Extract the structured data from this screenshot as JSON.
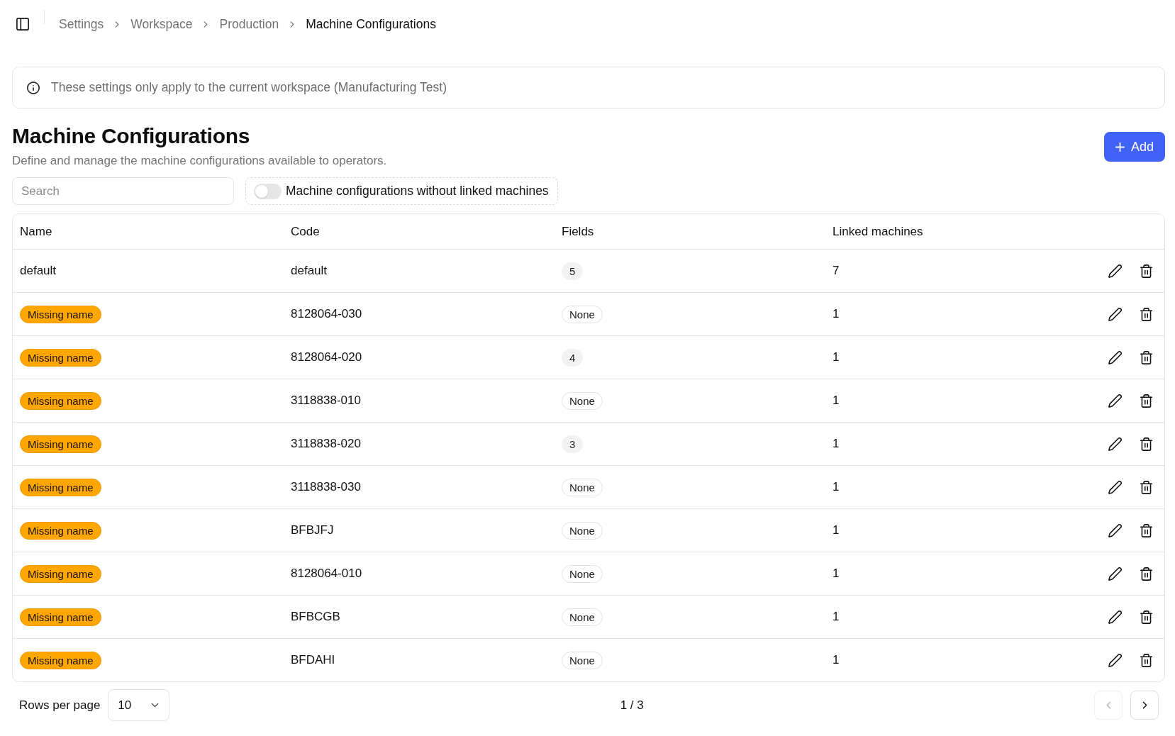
{
  "topbar": {
    "breadcrumb": [
      {
        "label": "Settings",
        "current": false
      },
      {
        "label": "Workspace",
        "current": false
      },
      {
        "label": "Production",
        "current": false
      },
      {
        "label": "Machine Configurations",
        "current": true
      }
    ]
  },
  "notice": {
    "text": "These settings only apply to the current workspace (Manufacturing Test)"
  },
  "header": {
    "title": "Machine Configurations",
    "subtitle": "Define and manage the machine configurations available to operators.",
    "add_button": "Add"
  },
  "filters": {
    "search": {
      "placeholder": "Search"
    },
    "toggle": {
      "label": "Machine configurations without linked machines",
      "on": false
    }
  },
  "table": {
    "columns": [
      "Name",
      "Code",
      "Fields",
      "Linked machines"
    ],
    "rows": [
      {
        "name": {
          "kind": "text",
          "text": "default"
        },
        "code": "default",
        "fields": {
          "kind": "count",
          "text": "5"
        },
        "linked_machines": "7"
      },
      {
        "name": {
          "kind": "warning",
          "text": "Missing name"
        },
        "code": "8128064-030",
        "fields": {
          "kind": "empty",
          "text": "None"
        },
        "linked_machines": "1"
      },
      {
        "name": {
          "kind": "warning",
          "text": "Missing name"
        },
        "code": "8128064-020",
        "fields": {
          "kind": "count",
          "text": "4"
        },
        "linked_machines": "1"
      },
      {
        "name": {
          "kind": "warning",
          "text": "Missing name"
        },
        "code": "3118838-010",
        "fields": {
          "kind": "empty",
          "text": "None"
        },
        "linked_machines": "1"
      },
      {
        "name": {
          "kind": "warning",
          "text": "Missing name"
        },
        "code": "3118838-020",
        "fields": {
          "kind": "count",
          "text": "3"
        },
        "linked_machines": "1"
      },
      {
        "name": {
          "kind": "warning",
          "text": "Missing name"
        },
        "code": "3118838-030",
        "fields": {
          "kind": "empty",
          "text": "None"
        },
        "linked_machines": "1"
      },
      {
        "name": {
          "kind": "warning",
          "text": "Missing name"
        },
        "code": "BFBJFJ",
        "fields": {
          "kind": "empty",
          "text": "None"
        },
        "linked_machines": "1"
      },
      {
        "name": {
          "kind": "warning",
          "text": "Missing name"
        },
        "code": "8128064-010",
        "fields": {
          "kind": "empty",
          "text": "None"
        },
        "linked_machines": "1"
      },
      {
        "name": {
          "kind": "warning",
          "text": "Missing name"
        },
        "code": "BFBCGB",
        "fields": {
          "kind": "empty",
          "text": "None"
        },
        "linked_machines": "1"
      },
      {
        "name": {
          "kind": "warning",
          "text": "Missing name"
        },
        "code": "BFDAHI",
        "fields": {
          "kind": "empty",
          "text": "None"
        },
        "linked_machines": "1"
      }
    ]
  },
  "pagination": {
    "rows_per_page_label": "Rows per page",
    "rows_per_page": "10",
    "page": "1 / 3",
    "previous": {
      "disabled": true
    },
    "next": {
      "disabled": false
    }
  }
}
